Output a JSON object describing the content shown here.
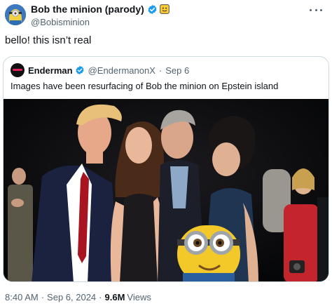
{
  "tweet": {
    "author_name": "Bob the minion (parody)",
    "author_handle": "@Bobisminion",
    "text": "bello! this isn’t real",
    "time": "8:40 AM",
    "separator": "·",
    "date": "Sep 6, 2024",
    "views_count": "9.6M",
    "views_label": "Views"
  },
  "quote": {
    "author_name": "Enderman",
    "author_handle": "@EndermanonX",
    "separator": "·",
    "date": "Sep 6",
    "text": "Images have been resurfacing of Bob the minion on Epstein island"
  },
  "colors": {
    "verified_blue": "#1d9bf0",
    "secondary_text": "#536471",
    "border": "#cfd9de"
  },
  "icons": {
    "verified": "verified-badge-icon",
    "emoji": "smiling-face-emoji",
    "more": "more-options-icon"
  }
}
